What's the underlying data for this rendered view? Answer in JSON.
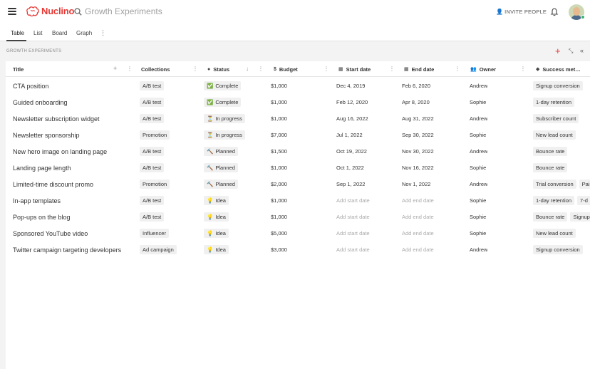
{
  "app": {
    "name": "Nuclino"
  },
  "search": {
    "placeholder": "Growth Experiments"
  },
  "header": {
    "invite_label": "INVITE PEOPLE"
  },
  "tabs": [
    {
      "label": "Table",
      "active": true
    },
    {
      "label": "List",
      "active": false
    },
    {
      "label": "Board",
      "active": false
    },
    {
      "label": "Graph",
      "active": false
    }
  ],
  "section": {
    "title": "GROWTH EXPERIMENTS"
  },
  "columns": {
    "title": "Title",
    "collections": "Collections",
    "status": "Status",
    "budget": "Budget",
    "start_date": "Start date",
    "end_date": "End date",
    "owner": "Owner",
    "success": "Success met…"
  },
  "rows": [
    {
      "title": "CTA position",
      "collection": "A/B test",
      "status": "Complete",
      "status_icon": "✅",
      "budget": "$1,000",
      "start": "Dec 4, 2019",
      "end": "Feb 6, 2020",
      "owner": "Andrew",
      "metrics": [
        "Signup conversion"
      ]
    },
    {
      "title": "Guided onboarding",
      "collection": "A/B test",
      "status": "Complete",
      "status_icon": "✅",
      "budget": "$1,000",
      "start": "Feb 12, 2020",
      "end": "Apr 8, 2020",
      "owner": "Sophie",
      "metrics": [
        "1-day retention"
      ]
    },
    {
      "title": "Newsletter subscription widget",
      "collection": "A/B test",
      "status": "In progress",
      "status_icon": "⏳",
      "budget": "$1,000",
      "start": "Aug 16, 2022",
      "end": "Aug 31, 2022",
      "owner": "Andrew",
      "metrics": [
        "Subscriber count"
      ]
    },
    {
      "title": "Newsletter sponsorship",
      "collection": "Promotion",
      "status": "In progress",
      "status_icon": "⏳",
      "budget": "$7,000",
      "start": "Jul 1, 2022",
      "end": "Sep 30, 2022",
      "owner": "Sophie",
      "metrics": [
        "New lead count"
      ]
    },
    {
      "title": "New hero image on landing page",
      "collection": "A/B test",
      "status": "Planned",
      "status_icon": "🔨",
      "budget": "$1,500",
      "start": "Oct 19, 2022",
      "end": "Nov 30, 2022",
      "owner": "Andrew",
      "metrics": [
        "Bounce rate"
      ]
    },
    {
      "title": "Landing page length",
      "collection": "A/B test",
      "status": "Planned",
      "status_icon": "🔨",
      "budget": "$1,000",
      "start": "Oct 1, 2022",
      "end": "Nov 16, 2022",
      "owner": "Sophie",
      "metrics": [
        "Bounce rate"
      ]
    },
    {
      "title": "Limited-time discount promo",
      "collection": "Promotion",
      "status": "Planned",
      "status_icon": "🔨",
      "budget": "$2,000",
      "start": "Sep 1, 2022",
      "end": "Nov 1, 2022",
      "owner": "Andrew",
      "metrics": [
        "Trial conversion",
        "Pai"
      ]
    },
    {
      "title": "In-app templates",
      "collection": "A/B test",
      "status": "Idea",
      "status_icon": "💡",
      "budget": "$1,000",
      "start": "Add start date",
      "end": "Add end date",
      "owner": "Sophie",
      "metrics": [
        "1-day retention",
        "7-d"
      ]
    },
    {
      "title": "Pop-ups on the blog",
      "collection": "A/B test",
      "status": "Idea",
      "status_icon": "💡",
      "budget": "$1,000",
      "start": "Add start date",
      "end": "Add end date",
      "owner": "Sophie",
      "metrics": [
        "Bounce rate",
        "Signup"
      ]
    },
    {
      "title": "Sponsored YouTube video",
      "collection": "Influencer",
      "status": "Idea",
      "status_icon": "💡",
      "budget": "$5,000",
      "start": "Add start date",
      "end": "Add end date",
      "owner": "Sophie",
      "metrics": [
        "New lead count"
      ]
    },
    {
      "title": "Twitter campaign targeting developers",
      "collection": "Ad campaign",
      "status": "Idea",
      "status_icon": "💡",
      "budget": "$3,000",
      "start": "Add start date",
      "end": "Add end date",
      "owner": "Andrew",
      "metrics": [
        "Signup conversion"
      ]
    }
  ],
  "icons": {
    "menu": "hamburger-icon",
    "search": "search-icon",
    "bell": "bell-icon",
    "invite": "add-person-icon",
    "add": "plus-icon",
    "collapse": "collapse-icon",
    "sidebar": "double-chevron-left-icon"
  },
  "colors": {
    "brand": "#e53935",
    "presence": "#3cb371"
  }
}
